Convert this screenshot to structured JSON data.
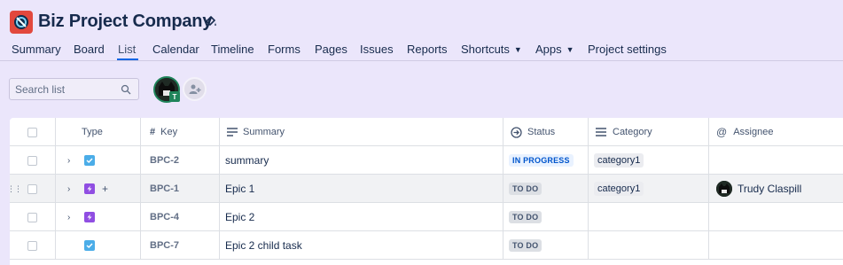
{
  "project": {
    "title": "Biz Project Company",
    "icon": "project-avatar-icon"
  },
  "tabs": [
    {
      "label": "Summary"
    },
    {
      "label": "Board"
    },
    {
      "label": "List"
    },
    {
      "label": "Calendar"
    },
    {
      "label": "Timeline"
    },
    {
      "label": "Forms"
    },
    {
      "label": "Pages"
    },
    {
      "label": "Issues"
    },
    {
      "label": "Reports"
    },
    {
      "label": "Shortcuts"
    },
    {
      "label": "Apps"
    },
    {
      "label": "Project settings"
    }
  ],
  "active_tab": "List",
  "search": {
    "placeholder": "Search list",
    "value": ""
  },
  "avatar_badge": "T",
  "columns": {
    "type": "Type",
    "key": "Key",
    "summary": "Summary",
    "status": "Status",
    "category": "Category",
    "assignee": "Assignee"
  },
  "rows": [
    {
      "key": "BPC-2",
      "type": "task",
      "summary": "summary",
      "status": "IN PROGRESS",
      "category": "category1",
      "assignee": ""
    },
    {
      "key": "BPC-1",
      "type": "epic",
      "summary": "Epic 1",
      "status": "TO DO",
      "category": "category1",
      "assignee": "Trudy Claspill"
    },
    {
      "key": "BPC-4",
      "type": "epic",
      "summary": "Epic 2",
      "status": "TO DO",
      "category": "",
      "assignee": ""
    },
    {
      "key": "BPC-7",
      "type": "task",
      "summary": "Epic 2 child task",
      "status": "TO DO",
      "category": "",
      "assignee": ""
    }
  ],
  "colors": {
    "background": "#ebe6fb",
    "accent": "#0c66e4",
    "project_icon": "#e2483d",
    "task_icon": "#4bade8",
    "epic_icon": "#904ee2"
  }
}
